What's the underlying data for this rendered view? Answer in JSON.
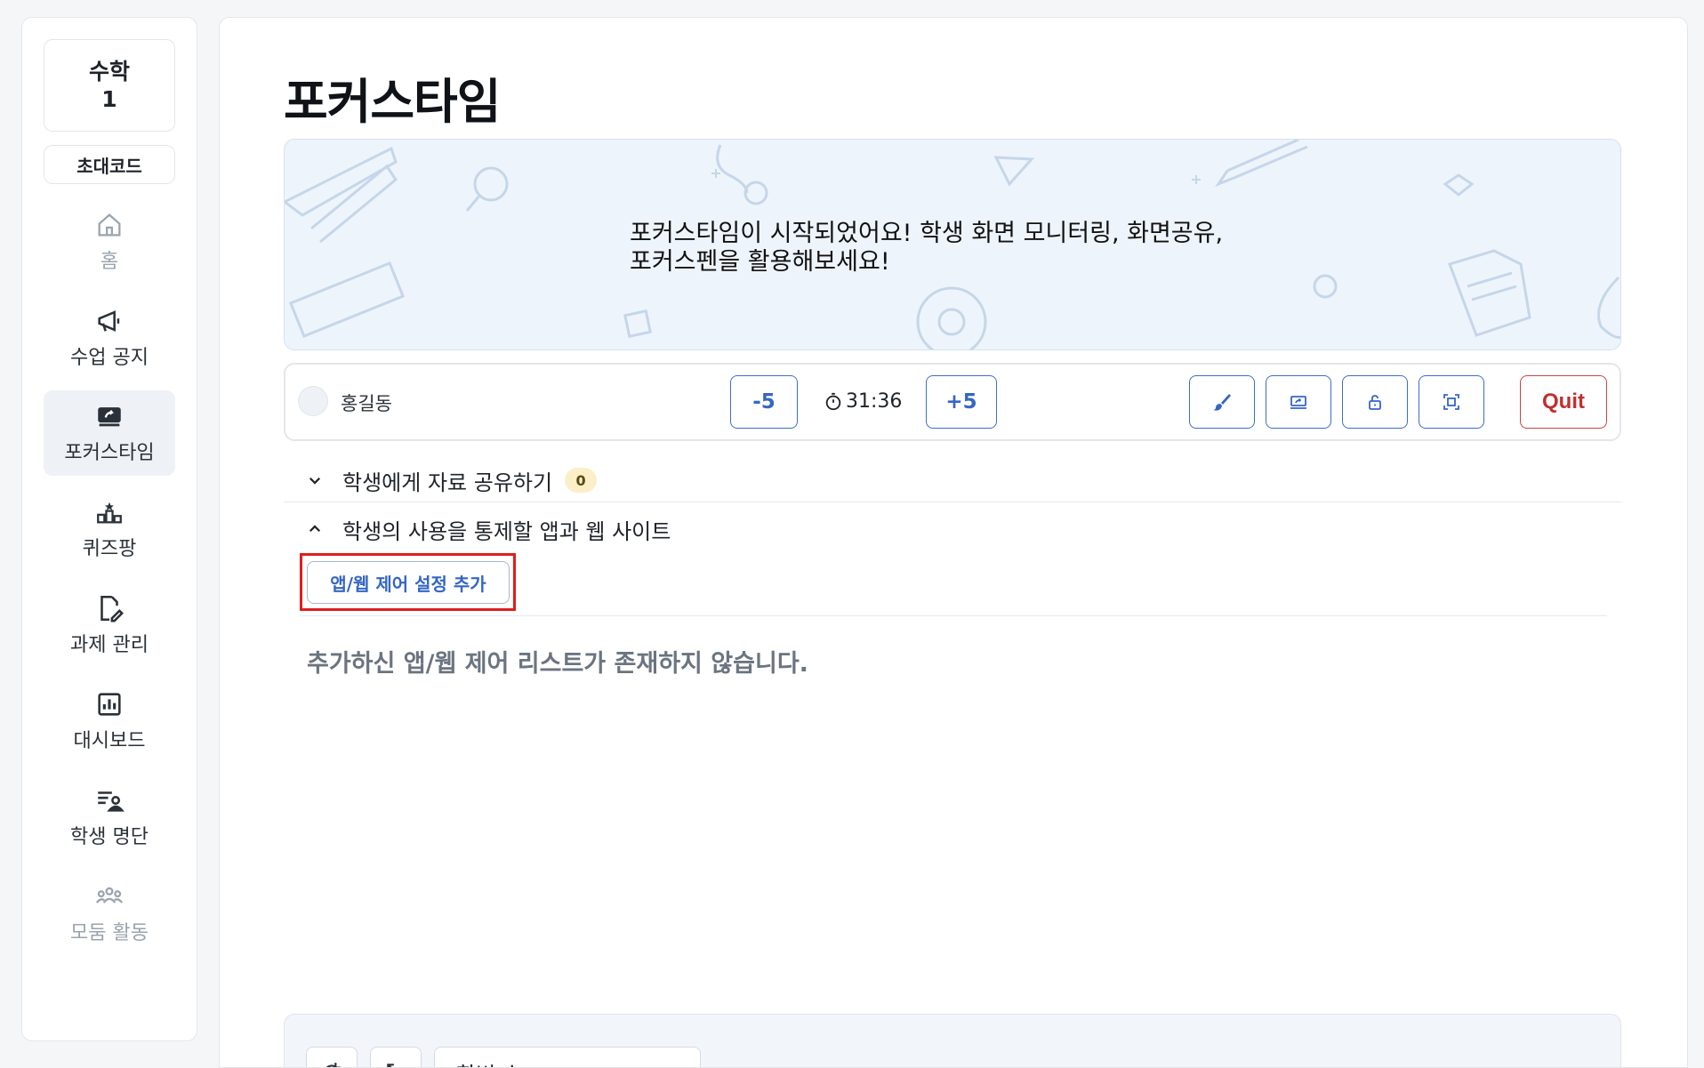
{
  "sidebar": {
    "class_card": {
      "subject": "수학",
      "number": "1"
    },
    "invite_code_label": "초대코드",
    "items": [
      {
        "label": "홈",
        "icon": "home-icon",
        "state": "disabled"
      },
      {
        "label": "수업 공지",
        "icon": "megaphone-icon",
        "state": "normal"
      },
      {
        "label": "포커스타임",
        "icon": "screen-share-icon",
        "state": "active"
      },
      {
        "label": "퀴즈팡",
        "icon": "podium-icon",
        "state": "normal"
      },
      {
        "label": "과제 관리",
        "icon": "edit-document-icon",
        "state": "normal"
      },
      {
        "label": "대시보드",
        "icon": "bar-chart-icon",
        "state": "normal"
      },
      {
        "label": "학생 명단",
        "icon": "student-list-icon",
        "state": "normal"
      },
      {
        "label": "모둠 활동",
        "icon": "group-icon",
        "state": "disabled"
      }
    ]
  },
  "main": {
    "title": "포커스타임",
    "banner": {
      "line1": "포커스타임이 시작되었어요! 학생 화면 모니터링, 화면공유,",
      "line2": "포커스펜을 활용해보세요!"
    },
    "control_bar": {
      "student_name": "홍길동",
      "minus_label": "-5",
      "timer": "31:36",
      "plus_label": "+5",
      "tools": [
        "brush-icon",
        "screen-share-icon",
        "lock-icon",
        "fullscreen-icon"
      ],
      "quit_label": "Quit"
    },
    "sections": [
      {
        "label": "학생에게 자료 공유하기",
        "count": "0",
        "expanded": false
      },
      {
        "label": "학생의 사용을 통제할 앱과 웹 사이트",
        "expanded": true
      }
    ],
    "add_control_label": "앱/웹 제어 설정 추가",
    "empty_message": "추가하신 앱/웹 제어 리스트가 존재하지 않습니다.",
    "bottom_panel": {
      "sort_label": "학번 순"
    }
  },
  "colors": {
    "accent": "#3566c4",
    "quit": "#c0302f",
    "highlight": "#e11d1d",
    "banner_bg": "#eef4fb"
  }
}
